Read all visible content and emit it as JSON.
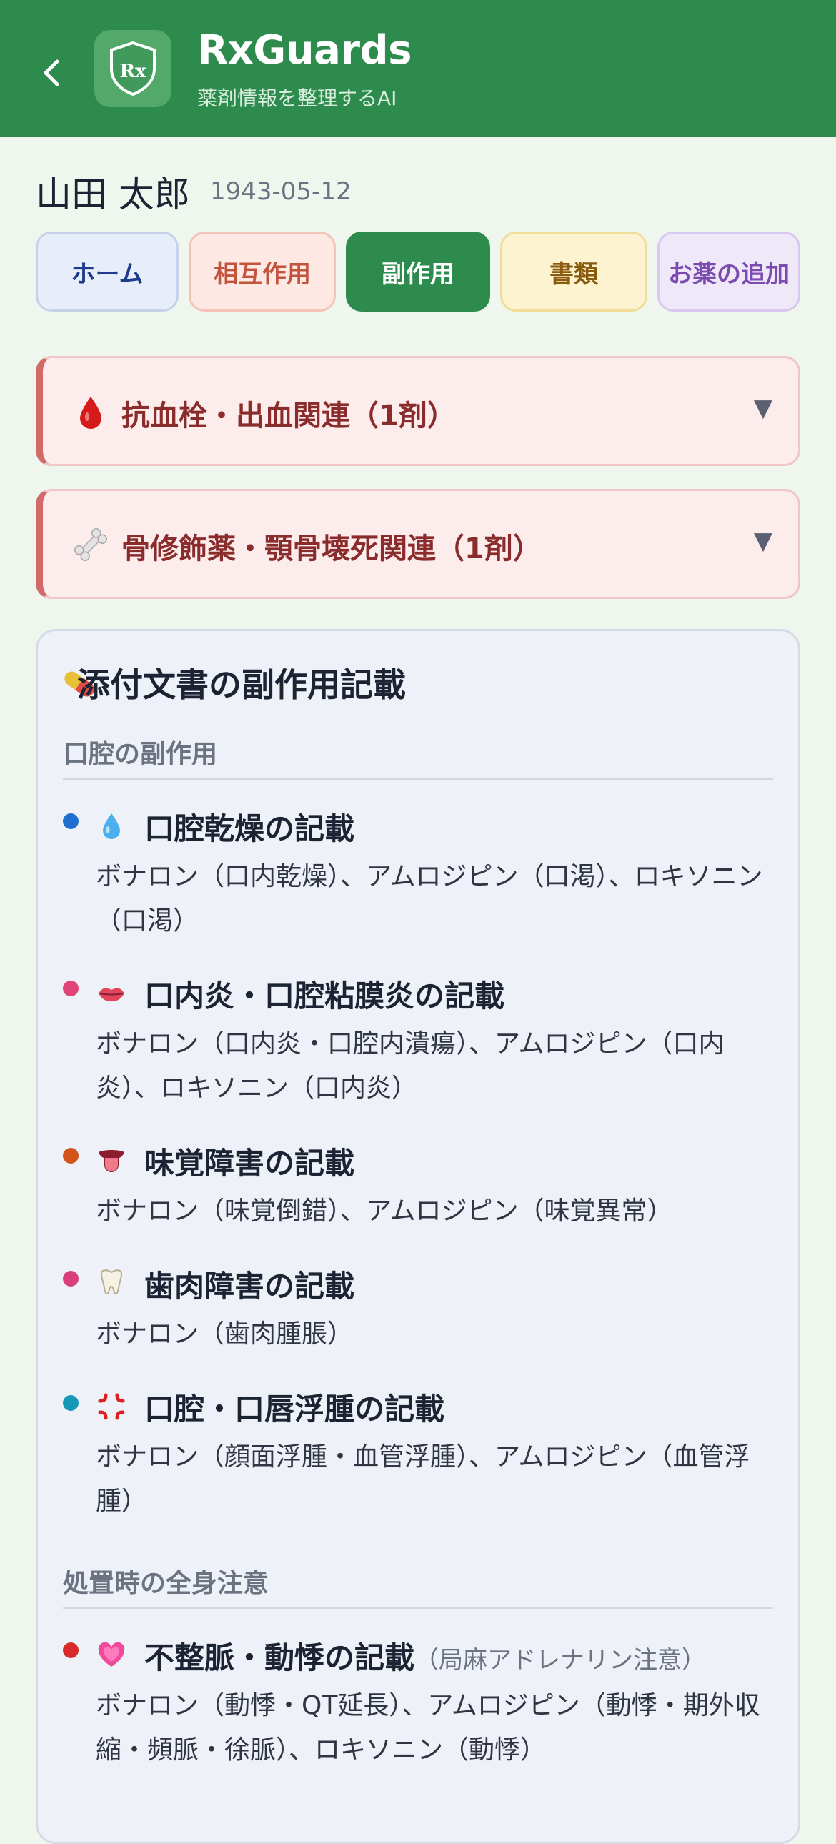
{
  "header": {
    "back_icon": "chevron-left-icon",
    "title": "RxGuards",
    "subtitle": "薬剤情報を整理するAI",
    "logo_text": "Rx"
  },
  "patient": {
    "name": "山田 太郎",
    "dob": "1943-05-12"
  },
  "tabs": [
    {
      "label": "ホーム"
    },
    {
      "label": "相互作用"
    },
    {
      "label": "副作用",
      "active": true
    },
    {
      "label": "書類"
    },
    {
      "label": "お薬の追加"
    }
  ],
  "accordions": [
    {
      "icon": "blood-drop-icon",
      "label": "抗血栓・出血関連（1剤）"
    },
    {
      "icon": "bone-icon",
      "label": "骨修飾薬・顎骨壊死関連（1剤）"
    }
  ],
  "card": {
    "icon": "pill-icon",
    "title": "添付文書の副作用記載",
    "sections": [
      {
        "title": "口腔の副作用",
        "items": [
          {
            "icon": "water-drop-icon",
            "dot_color": "#1f6fd1",
            "title": "口腔乾燥の記載",
            "desc": "ボナロン（口内乾燥）、アムロジピン（口渇）、ロキソニン（口渇）"
          },
          {
            "icon": "lips-icon",
            "dot_color": "#e0457a",
            "title": "口内炎・口腔粘膜炎の記載",
            "desc": "ボナロン（口内炎・口腔内潰瘍）、アムロジピン（口内炎）、ロキソニン（口内炎）"
          },
          {
            "icon": "tongue-icon",
            "dot_color": "#d1541b",
            "title": "味覚障害の記載",
            "desc": "ボナロン（味覚倒錯）、アムロジピン（味覚異常）"
          },
          {
            "icon": "tooth-icon",
            "dot_color": "#d9407a",
            "title": "歯肉障害の記載",
            "desc": "ボナロン（歯肉腫脹）"
          },
          {
            "icon": "anger-icon",
            "dot_color": "#1597b8",
            "title": "口腔・口唇浮腫の記載",
            "desc": "ボナロン（顔面浮腫・血管浮腫）、アムロジピン（血管浮腫）"
          }
        ]
      },
      {
        "title": "処置時の全身注意",
        "items": [
          {
            "icon": "heart-icon",
            "dot_color": "#d92b2b",
            "title": "不整脈・動悸の記載",
            "note": "（局麻アドレナリン注意）",
            "desc": "ボナロン（動悸・QT延長）、アムロジピン（動悸・期外収縮・頻脈・徐脈）、ロキソニン（動悸）"
          }
        ]
      }
    ]
  },
  "colors": {
    "header_bg": "#2e8b4e",
    "page_bg": "#eef6ee",
    "accordion_bg": "#fdecec",
    "accordion_text": "#8b2c2c"
  }
}
